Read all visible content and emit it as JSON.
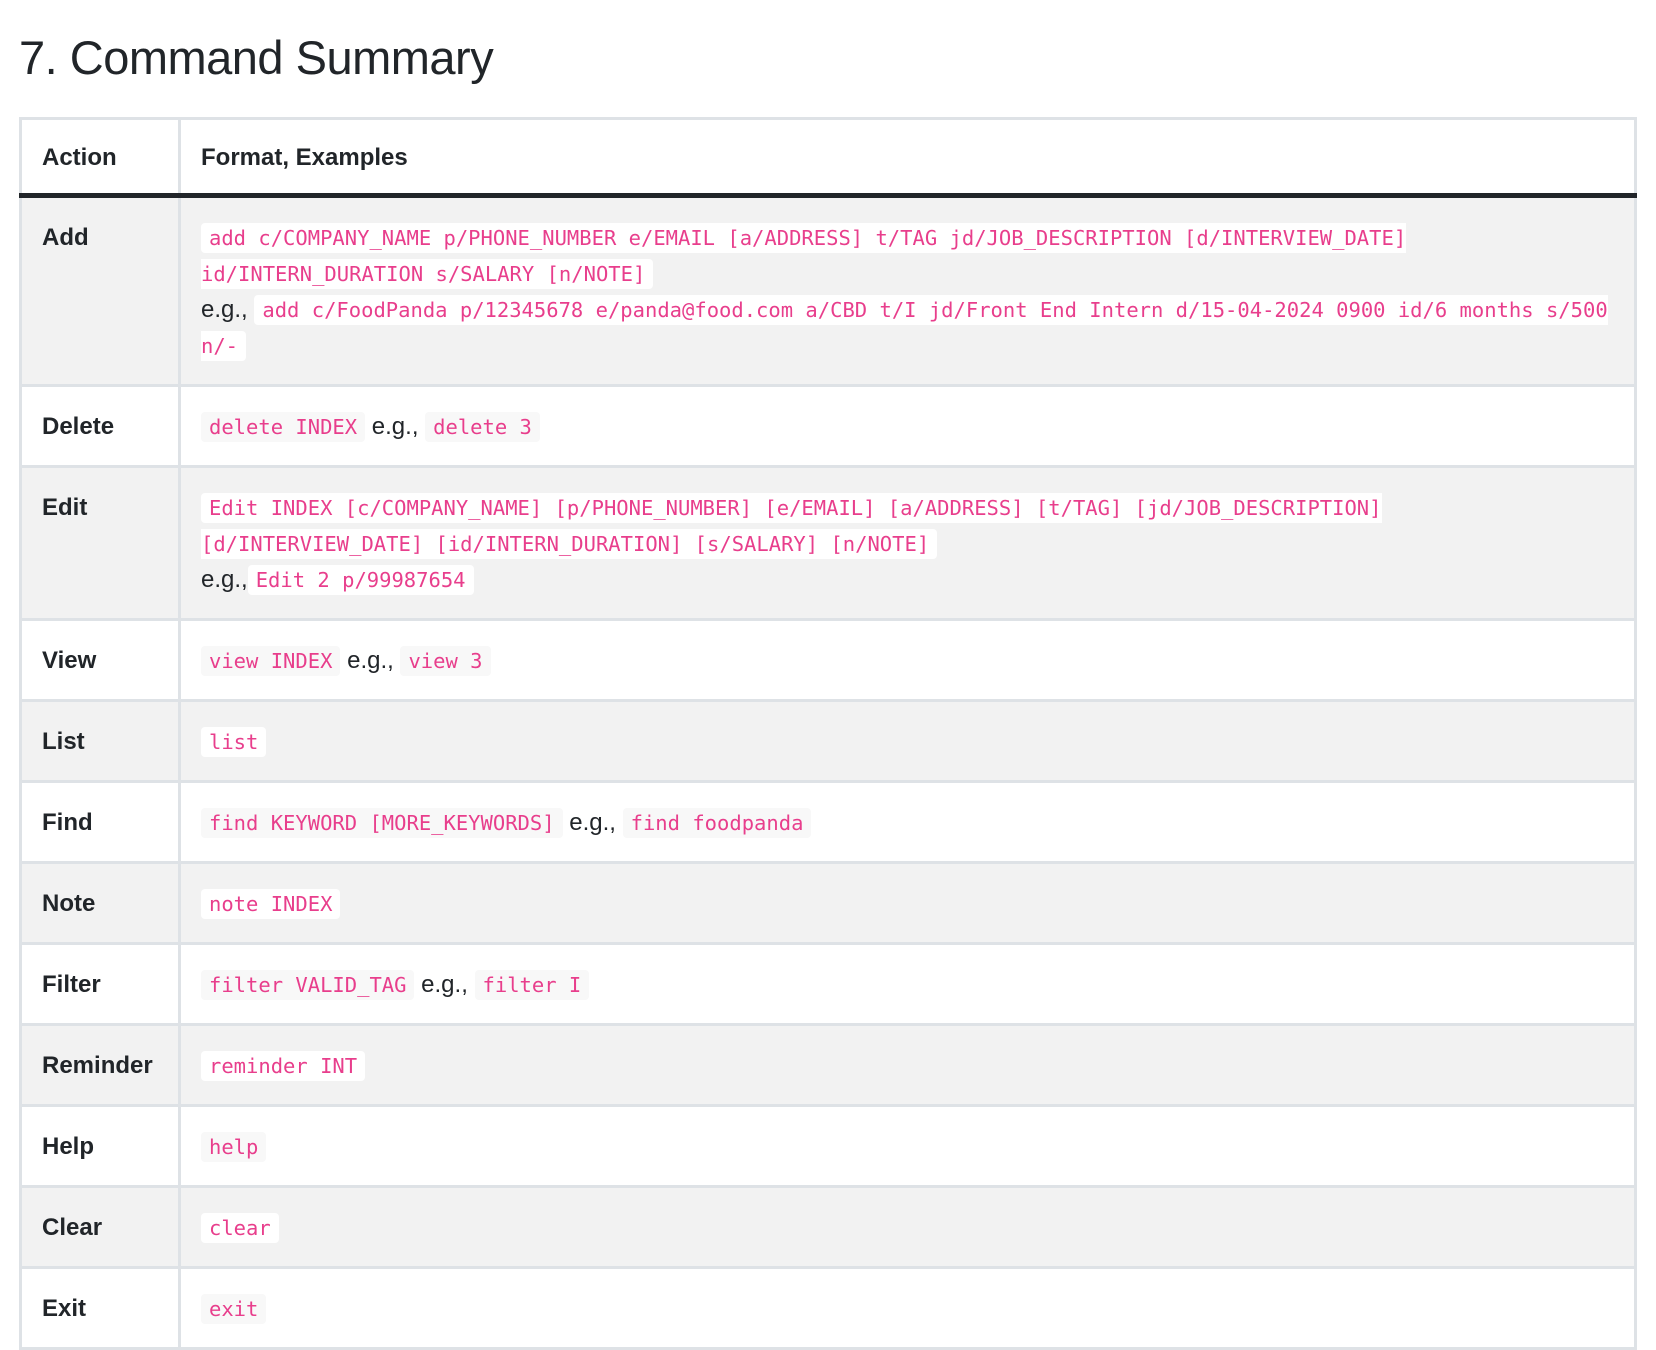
{
  "section_title": "7. Command Summary",
  "table": {
    "headers": {
      "action": "Action",
      "format": "Format, Examples"
    },
    "rows": [
      {
        "action": "Add",
        "format": "add c/COMPANY_NAME p/PHONE_NUMBER e/EMAIL [a/ADDRESS] t/TAG jd/JOB_DESCRIPTION [d/INTERVIEW_DATE] id/INTERN_DURATION s/SALARY [n/NOTE]",
        "eg_label": "e.g.,",
        "example": "add c/FoodPanda p/12345678 e/panda@food.com a/CBD t/I jd/Front End Intern d/15-04-2024 0900 id/6 months s/500 n/-"
      },
      {
        "action": "Delete",
        "format": "delete INDEX",
        "eg_label": "e.g.,",
        "example": "delete 3"
      },
      {
        "action": "Edit",
        "format": "Edit INDEX [c/COMPANY_NAME] [p/PHONE_NUMBER] [e/EMAIL] [a/ADDRESS] [t/TAG] [jd/JOB_DESCRIPTION] [d/INTERVIEW_DATE] [id/INTERN_DURATION] [s/SALARY] [n/NOTE]",
        "eg_label": "e.g.,",
        "example": "Edit 2 p/99987654"
      },
      {
        "action": "View",
        "format": "view INDEX",
        "eg_label": "e.g.,",
        "example": "view 3"
      },
      {
        "action": "List",
        "format": "list"
      },
      {
        "action": "Find",
        "format": "find KEYWORD [MORE_KEYWORDS]",
        "eg_label": "e.g.,",
        "example": "find foodpanda"
      },
      {
        "action": "Note",
        "format": "note INDEX"
      },
      {
        "action": "Filter",
        "format": "filter VALID_TAG",
        "eg_label": "e.g.,",
        "example": "filter I"
      },
      {
        "action": "Reminder",
        "format": "reminder INT"
      },
      {
        "action": "Help",
        "format": "help"
      },
      {
        "action": "Clear",
        "format": "clear"
      },
      {
        "action": "Exit",
        "format": "exit"
      }
    ]
  },
  "colors": {
    "code_text": "#e83e8c",
    "border": "#dee2e6",
    "header_rule": "#212529",
    "stripe": "#f2f2f2"
  }
}
